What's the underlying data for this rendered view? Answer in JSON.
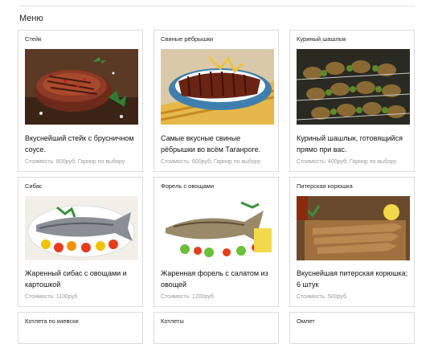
{
  "page": {
    "heading": "Меню"
  },
  "menu": [
    {
      "title": "Стейк",
      "description": "Вкуснейший стейк с брусничном соусе.",
      "price": "Стоимость: 800руб; Гарнир по выбору",
      "image": "steak"
    },
    {
      "title": "Свиные рёбрышки",
      "description": "Самые вкусные свиные рёбрышки во всём Таганроге.",
      "price": "Стоимость: 600руб; Гарнир по выбору",
      "image": "ribs"
    },
    {
      "title": "Куриный шашлык",
      "description": "Куриный шашлык, готовящийся прямо при вас.",
      "price": "Стоимость: 400руб; Гарнир по выбору",
      "image": "skewers"
    },
    {
      "title": "Сибас",
      "description": "Жаренный сибас с овощами и картошкой",
      "price": "Стоимость: 1100руб",
      "image": "seabass"
    },
    {
      "title": "Форель с овощами",
      "description": "Жаренная форель с салатом из овощей",
      "price": "Стоимость: 1200руб",
      "image": "trout"
    },
    {
      "title": "Питерская корюшка",
      "description": "Вкуснейшая питерская корюшка; 6 штук",
      "price": "Стоимость: 500руб",
      "image": "smelt"
    },
    {
      "title": "Котлета по киевски",
      "description": "",
      "price": "",
      "image": ""
    },
    {
      "title": "Котлеты",
      "description": "",
      "price": "",
      "image": ""
    },
    {
      "title": "Омлет",
      "description": "",
      "price": "",
      "image": ""
    }
  ]
}
